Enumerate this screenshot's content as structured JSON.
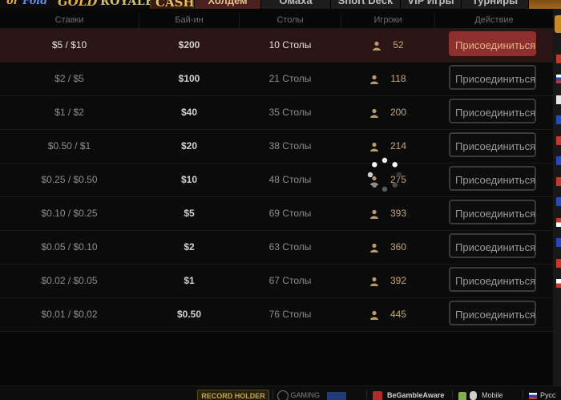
{
  "topbar": {
    "logos": {
      "fold_prefix": "or ",
      "fold": "Fold",
      "gold": "GOLD",
      "royale": "ROYALE",
      "cash": "CASH"
    },
    "tabs": [
      {
        "label": "Холдем",
        "active": true
      },
      {
        "label": "Омаха",
        "active": false
      },
      {
        "label": "Short Deck",
        "active": false
      },
      {
        "label": "VIP Игры",
        "active": false
      },
      {
        "label": "Турниры",
        "active": false
      }
    ]
  },
  "columns": {
    "stakes": "Ставки",
    "buyin": "Бай-ин",
    "tables": "Столы",
    "players": "Игроки",
    "action": "Действие"
  },
  "rows": [
    {
      "stakes": "$5 / $10",
      "buyin": "$200",
      "tables": "10 Столы",
      "players": "52",
      "action": "Присоединиться",
      "highlight": true
    },
    {
      "stakes": "$2 / $5",
      "buyin": "$100",
      "tables": "21 Столы",
      "players": "118",
      "action": "Присоединиться"
    },
    {
      "stakes": "$1 / $2",
      "buyin": "$40",
      "tables": "35 Столы",
      "players": "200",
      "action": "Присоединиться"
    },
    {
      "stakes": "$0.50 / $1",
      "buyin": "$20",
      "tables": "38 Столы",
      "players": "214",
      "action": "Присоединиться"
    },
    {
      "stakes": "$0.25 / $0.50",
      "buyin": "$10",
      "tables": "48 Столы",
      "players": "275",
      "action": "Присоединиться"
    },
    {
      "stakes": "$0.10 / $0.25",
      "buyin": "$5",
      "tables": "69 Столы",
      "players": "393",
      "action": "Присоединиться"
    },
    {
      "stakes": "$0.05 / $0.10",
      "buyin": "$2",
      "tables": "63 Столы",
      "players": "360",
      "action": "Присоединиться"
    },
    {
      "stakes": "$0.02 / $0.05",
      "buyin": "$1",
      "tables": "67 Столы",
      "players": "392",
      "action": "Присоединиться"
    },
    {
      "stakes": "$0.01 / $0.02",
      "buyin": "$0.50",
      "tables": "76 Столы",
      "players": "445",
      "action": "Присоединиться"
    }
  ],
  "footer": {
    "record_holder": "RECORD HOLDER",
    "gaming": "GAMING",
    "begambleaware": "BeGambleAware",
    "mobile": "Mobile",
    "language": "Русс"
  },
  "colors": {
    "accent_red": "#8c2f2d",
    "highlight_row": "#2b1414",
    "players_text": "#c7a57a",
    "background": "#070707"
  },
  "icons": {
    "player": "person-icon",
    "loading": "spinner-icon",
    "apple": "apple-icon",
    "android": "android-icon"
  }
}
